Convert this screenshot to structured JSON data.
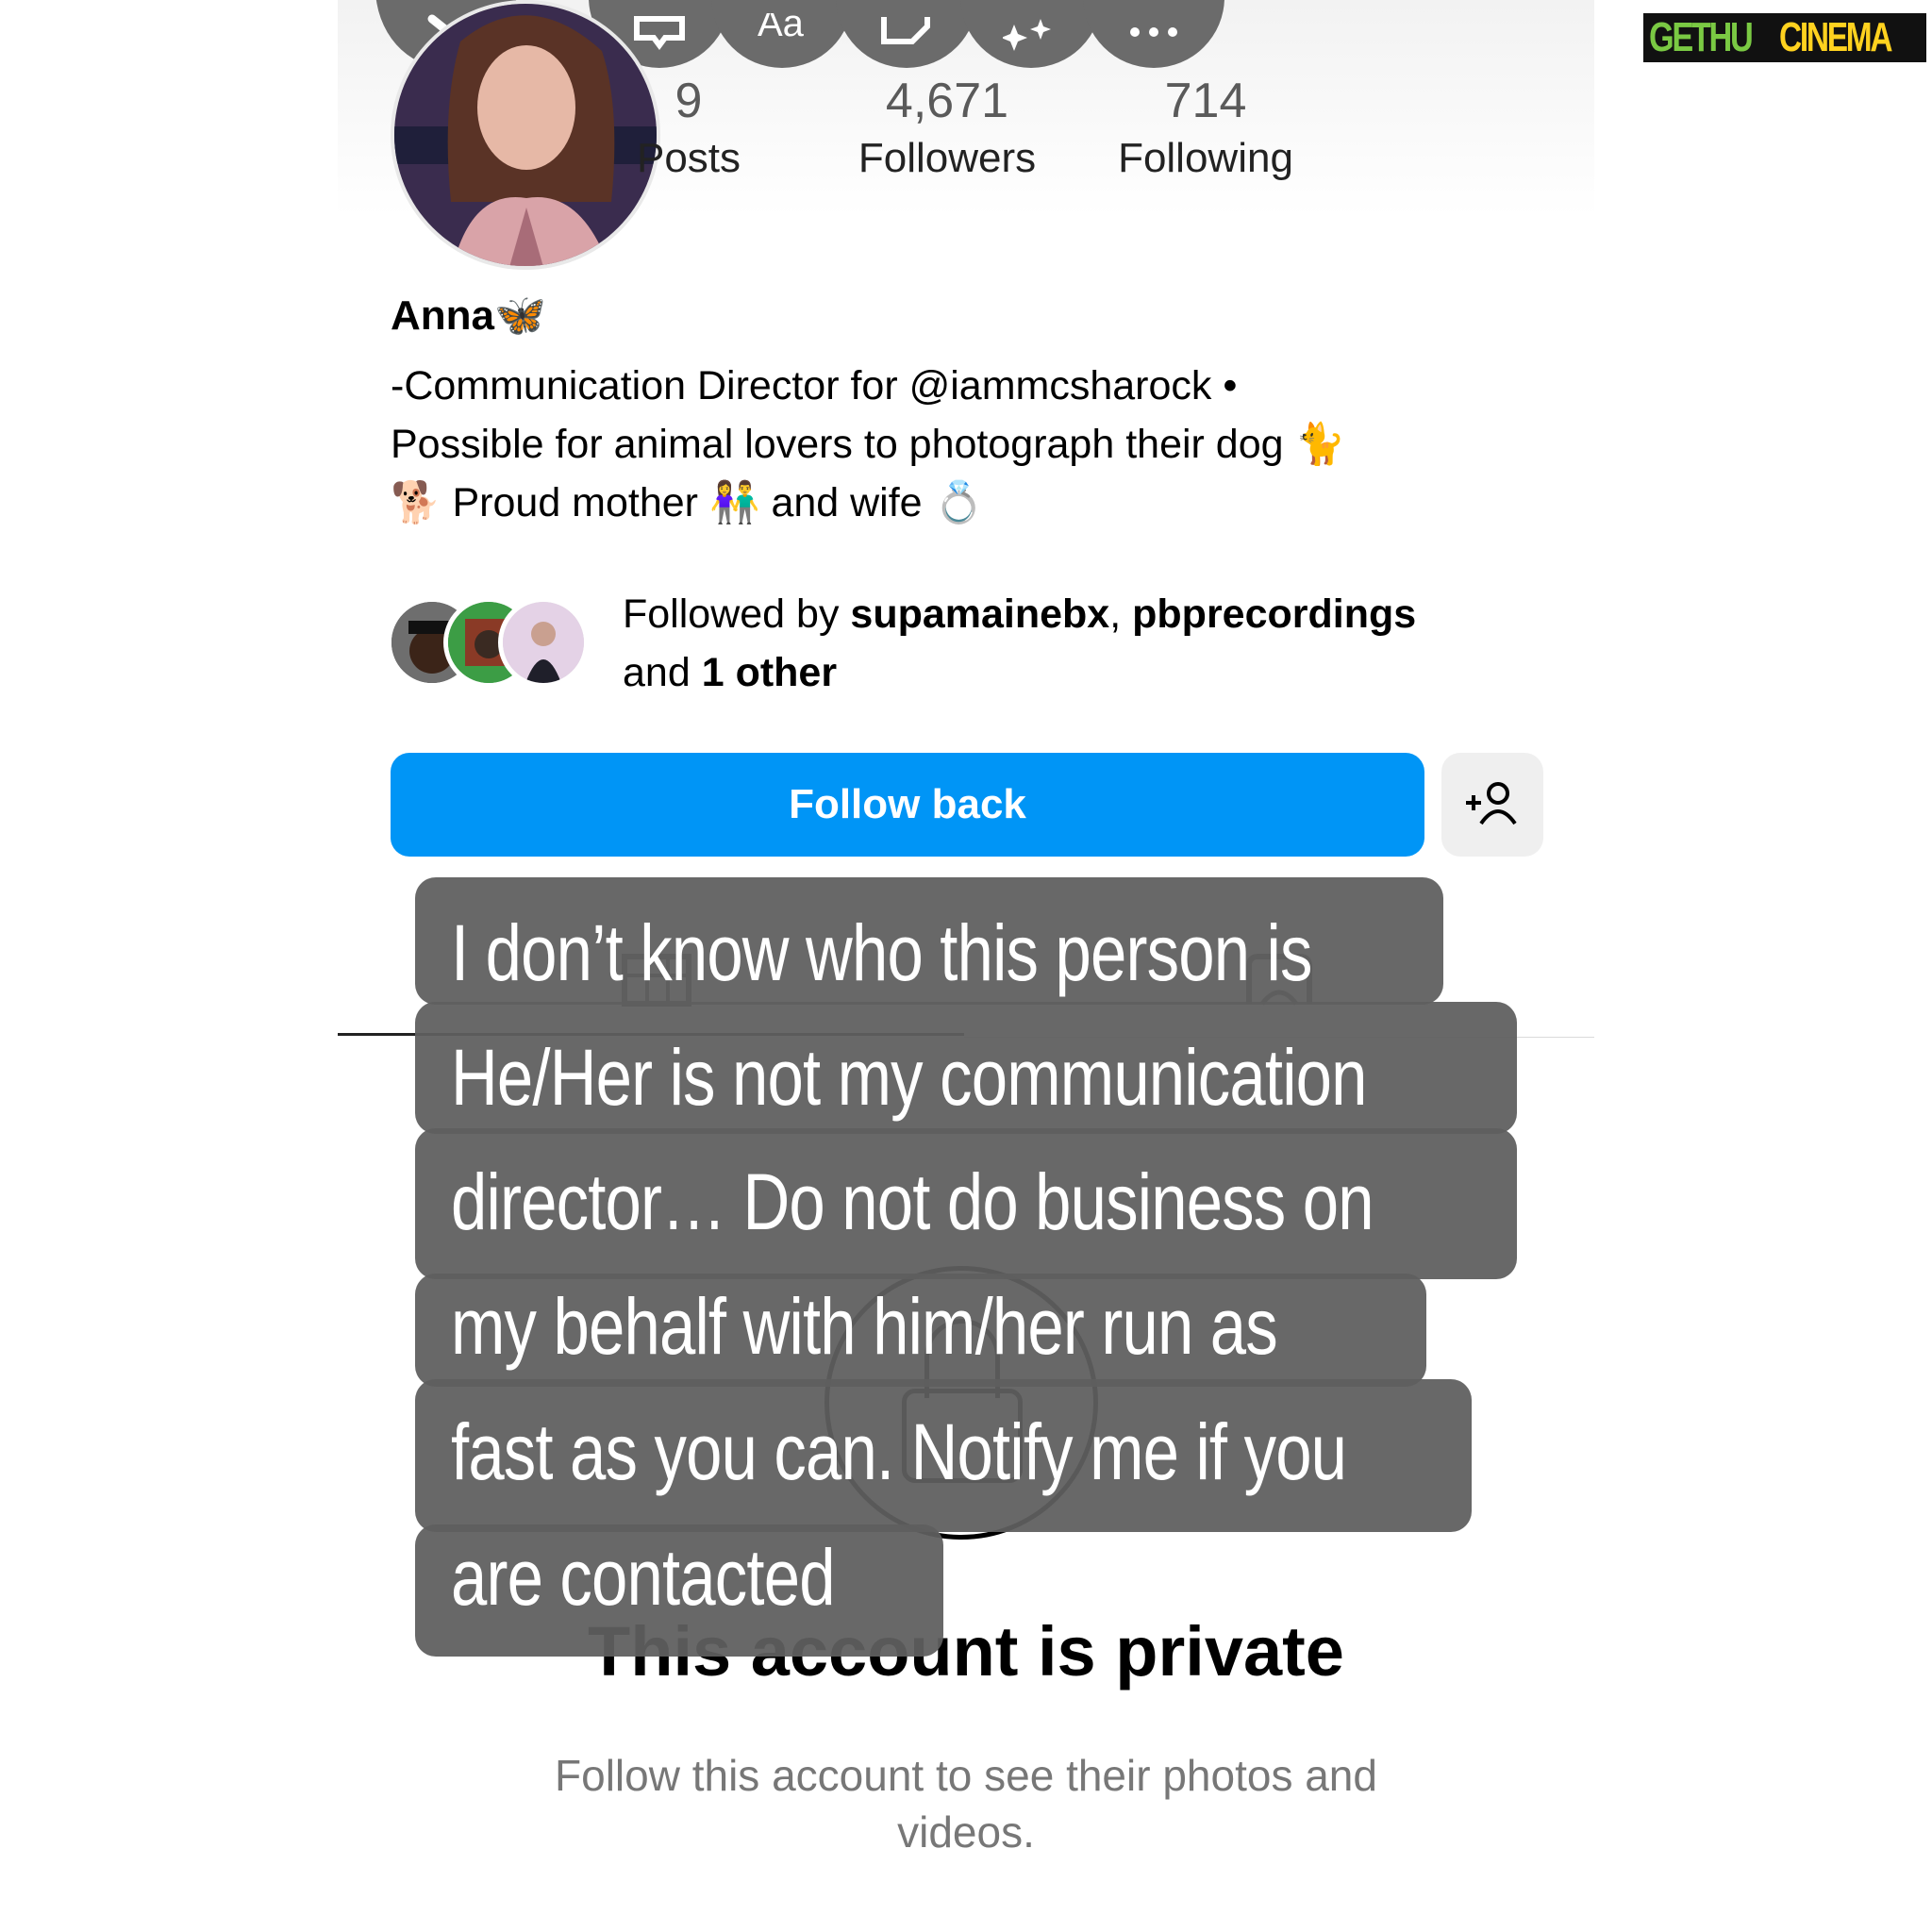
{
  "profile": {
    "stats": [
      {
        "value": "9",
        "label": "Posts"
      },
      {
        "value": "4,671",
        "label": "Followers"
      },
      {
        "value": "714",
        "label": "Following"
      }
    ],
    "name": "Anna🦋",
    "bio_lines": [
      "-Communication Director for @iammcsharock •",
      "Possible for animal lovers to photograph their dog 🐈",
      "🐕 Proud mother 👫 and wife 💍"
    ],
    "followed_by": {
      "prefix": "Followed by ",
      "user1": "supamainebx",
      "sep": ", ",
      "user2": "pbprecordings",
      "and": "and ",
      "other": "1 other"
    },
    "follow_button": "Follow back",
    "top_icons": [
      "back-arrow-icon",
      "threads-icon",
      "text-icon",
      "sticker-icon",
      "sparkle-icon",
      "more-icon"
    ],
    "private_title": "This account is private",
    "private_subtitle": "Follow this account to see their photos and videos."
  },
  "overlay": {
    "lines": [
      "I don’t know who this person is",
      "He/Her is not my communication",
      "director… Do not do business on",
      "my behalf with him/her run as",
      "fast as you can. Notify me if you",
      "are contacted"
    ]
  },
  "watermark": {
    "part1": "GETHU",
    "part2": "CINEMA"
  },
  "colors": {
    "follow_button": "#0095f6",
    "overlay_bg": "#5f5f5f"
  }
}
